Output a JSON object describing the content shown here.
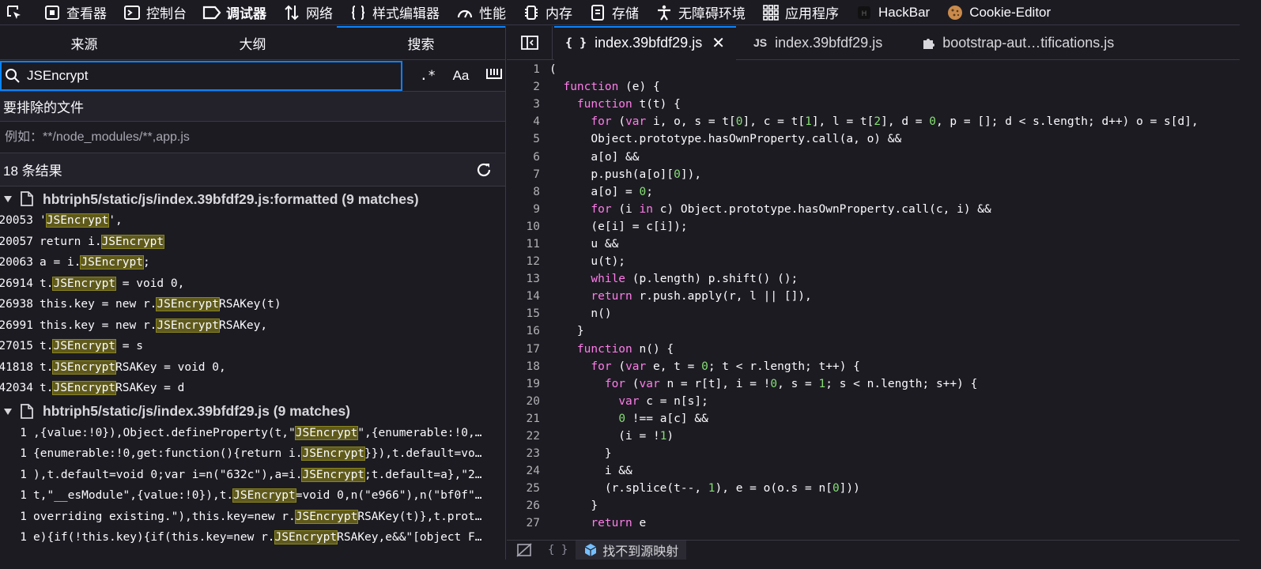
{
  "toolbar": {
    "tools": [
      {
        "label": "查看器",
        "icon": "inspector-icon"
      },
      {
        "label": "控制台",
        "icon": "console-icon"
      },
      {
        "label": "调试器",
        "icon": "debugger-icon",
        "active": true
      },
      {
        "label": "网络",
        "icon": "network-icon"
      },
      {
        "label": "样式编辑器",
        "icon": "style-editor-icon"
      },
      {
        "label": "性能",
        "icon": "performance-icon"
      },
      {
        "label": "内存",
        "icon": "memory-icon"
      },
      {
        "label": "存储",
        "icon": "storage-icon"
      },
      {
        "label": "无障碍环境",
        "icon": "accessibility-icon"
      },
      {
        "label": "应用程序",
        "icon": "application-icon"
      },
      {
        "label": "HackBar",
        "icon": "hackbar-icon"
      },
      {
        "label": "Cookie-Editor",
        "icon": "cookie-icon"
      }
    ]
  },
  "left": {
    "tabs": [
      "来源",
      "大纲",
      "搜索"
    ],
    "search_value": "JSEncrypt",
    "options": [
      ".*",
      "Aa"
    ],
    "exclude_label": "要排除的文件",
    "exclude_placeholder": "例如：**/node_modules/**,app.js",
    "result_count": "18 条结果",
    "files": [
      {
        "title": "hbtriph5/static/js/index.39bfdf29.js:formatted (9 matches)",
        "lines": [
          {
            "ln": "20053",
            "pre": "'",
            "match": "JSEncrypt",
            "post": "',"
          },
          {
            "ln": "20057",
            "pre": "return i.",
            "match": "JSEncrypt",
            "post": ""
          },
          {
            "ln": "20063",
            "pre": "a = i.",
            "match": "JSEncrypt",
            "post": ";"
          },
          {
            "ln": "26914",
            "pre": "t.",
            "match": "JSEncrypt",
            "post": " = void 0,"
          },
          {
            "ln": "26938",
            "pre": "this.key = new r.",
            "match": "JSEncrypt",
            "post": "RSAKey(t)"
          },
          {
            "ln": "26991",
            "pre": "this.key = new r.",
            "match": "JSEncrypt",
            "post": "RSAKey,"
          },
          {
            "ln": "27015",
            "pre": "t.",
            "match": "JSEncrypt",
            "post": " = s"
          },
          {
            "ln": "41818",
            "pre": "t.",
            "match": "JSEncrypt",
            "post": "RSAKey = void 0,"
          },
          {
            "ln": "42034",
            "pre": "t.",
            "match": "JSEncrypt",
            "post": "RSAKey = d"
          }
        ]
      },
      {
        "title": "hbtriph5/static/js/index.39bfdf29.js (9 matches)",
        "lines": [
          {
            "ln": "1",
            "pre": ",{value:!0}),Object.defineProperty(t,\"",
            "match": "JSEncrypt",
            "post": "\",{enumerable:!0,…"
          },
          {
            "ln": "1",
            "pre": "{enumerable:!0,get:function(){return i.",
            "match": "JSEncrypt",
            "post": "}}),t.default=vo…"
          },
          {
            "ln": "1",
            "pre": "),t.default=void 0;var i=n(\"632c\"),a=i.",
            "match": "JSEncrypt",
            "post": ";t.default=a},\"2…"
          },
          {
            "ln": "1",
            "pre": "t,\"__esModule\",{value:!0}),t.",
            "match": "JSEncrypt",
            "post": "=void 0,n(\"e966\"),n(\"bf0f\"…"
          },
          {
            "ln": "1",
            "pre": "overriding existing.\"),this.key=new r.",
            "match": "JSEncrypt",
            "post": "RSAKey(t)},t.prot…"
          },
          {
            "ln": "1",
            "pre": "e){if(!this.key){if(this.key=new r.",
            "match": "JSEncrypt",
            "post": "RSAKey,e&&\"[object F…"
          }
        ]
      }
    ]
  },
  "editor": {
    "tabs": [
      {
        "label": "index.39bfdf29.js",
        "prefix": "{ }",
        "active": true
      },
      {
        "label": "index.39bfdf29.js",
        "prefix": "JS",
        "active": false
      },
      {
        "label": "bootstrap-aut…tifications.js",
        "prefix": "",
        "icon": "extension-icon",
        "active": false
      }
    ],
    "lines": [
      "(",
      "  function (e) {",
      "    function t(t) {",
      "      for (var i, o, s = t[0], c = t[1], l = t[2], d = 0, p = []; d < s.length; d++) o = s[d],",
      "      Object.prototype.hasOwnProperty.call(a, o) &&",
      "      a[o] &&",
      "      p.push(a[o][0]),",
      "      a[o] = 0;",
      "      for (i in c) Object.prototype.hasOwnProperty.call(c, i) &&",
      "      (e[i] = c[i]);",
      "      u &&",
      "      u(t);",
      "      while (p.length) p.shift() ();",
      "      return r.push.apply(r, l || []),",
      "      n()",
      "    }",
      "    function n() {",
      "      for (var e, t = 0; t < r.length; t++) {",
      "        for (var n = r[t], i = !0, s = 1; s < n.length; s++) {",
      "          var c = n[s];",
      "          0 !== a[c] &&",
      "          (i = !1)",
      "        }",
      "        i &&",
      "        (r.splice(t--, 1), e = o(o.s = n[0]))",
      "      }",
      "      return e"
    ],
    "footer_label": "找不到源映射",
    "footer_pretty": "{ }"
  }
}
